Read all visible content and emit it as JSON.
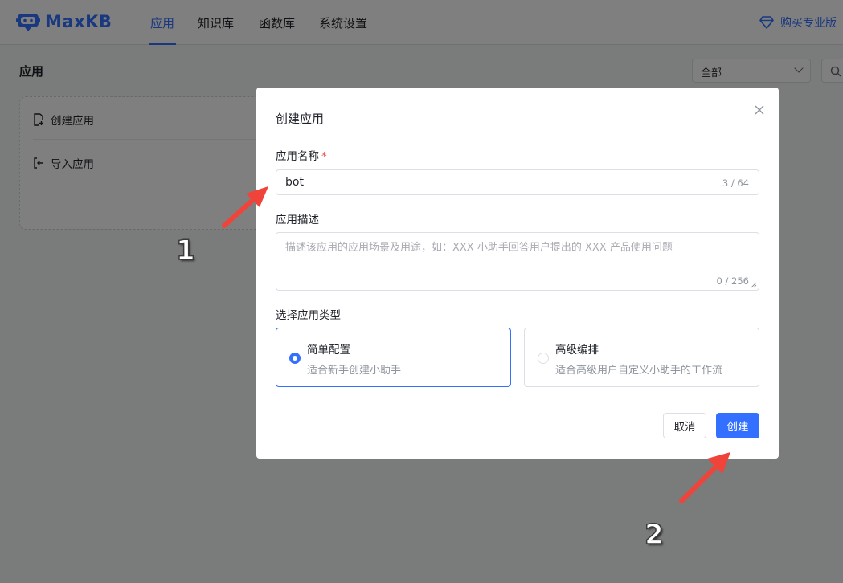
{
  "app": {
    "logo_text": "MaxKB",
    "brand_color": "#3370ff",
    "logo_icon": "robot-icon"
  },
  "nav": {
    "items": [
      {
        "label": "应用",
        "active": true
      },
      {
        "label": "知识库",
        "active": false
      },
      {
        "label": "函数库",
        "active": false
      },
      {
        "label": "系统设置",
        "active": false
      }
    ],
    "upgrade_label": "购买专业版",
    "upgrade_icon": "diamond-icon"
  },
  "page": {
    "title": "应用",
    "filter_value": "全部",
    "search_icon": "search-icon",
    "create_card": {
      "create_label": "创建应用",
      "import_label": "导入应用"
    }
  },
  "dialog": {
    "title": "创建应用",
    "name_label": "应用名称",
    "name_required_mark": "*",
    "name_value": "bot",
    "name_count": "3 / 64",
    "desc_label": "应用描述",
    "desc_placeholder": "描述该应用的应用场景及用途，如：XXX 小助手回答用户提出的 XXX 产品使用问题",
    "desc_count": "0 / 256",
    "type_label": "选择应用类型",
    "types": [
      {
        "name": "简单配置",
        "desc": "适合新手创建小助手",
        "selected": true
      },
      {
        "name": "高级编排",
        "desc": "适合高级用户自定义小助手的工作流",
        "selected": false
      }
    ],
    "cancel_label": "取消",
    "create_label": "创建"
  },
  "annotations": {
    "step1": "1",
    "step2": "2",
    "arrow_color": "#f0443a"
  }
}
